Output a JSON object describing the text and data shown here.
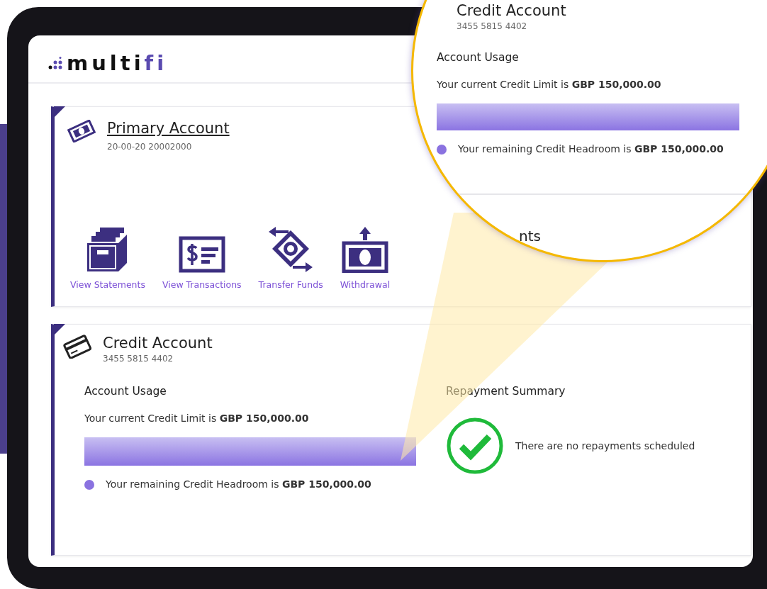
{
  "logo": {
    "parts": [
      {
        "text": "multi",
        "accent": false
      },
      {
        "text": "fi",
        "accent": true
      }
    ]
  },
  "primary_account": {
    "title": "Primary Account",
    "number": "20-00-20 20002000",
    "actions": [
      {
        "kind": "statements",
        "label": "View Statements"
      },
      {
        "kind": "transactions",
        "label": "View Transactions"
      },
      {
        "kind": "transfer",
        "label": "Transfer Funds"
      },
      {
        "kind": "withdrawal",
        "label": "Withdrawal"
      }
    ]
  },
  "credit_account": {
    "title": "Credit Account",
    "number": "3455 5815 4402",
    "usage": {
      "heading": "Account Usage",
      "limit_text": "Your current Credit Limit is **GBP 150,000.00**",
      "level": 1,
      "headroom_text": "Your remaining Credit Headroom is **GBP 150,000.00**"
    },
    "repayment": {
      "heading": "Repayment Summary",
      "message": "There are no repayments scheduled"
    }
  },
  "magnifier": {
    "title": "Credit Account",
    "number": "3455 5815 4402",
    "heading": "Account Usage",
    "limit_text": "Your current Credit Limit is **GBP 150,000.00**",
    "level": 1,
    "headroom_text": "Your remaining Credit Headroom is **GBP 150,000.00**",
    "next_heading_fragment": "nts"
  }
}
